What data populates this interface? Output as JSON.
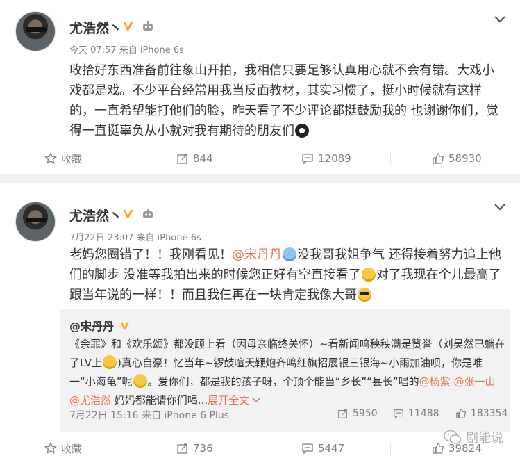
{
  "posts": [
    {
      "username": "尤浩然丶",
      "meta": "今天 07:57 来自 iPhone 6s",
      "text": "收拾好东西准备前往象山开拍，我相信只要足够认真用心就不会有错。大戏小戏都是戏。不少平台经常用我当反面教材，其实习惯了，挺小时候就有这样的，一直希望能打他们的脸，昨天看了不少评论都挺鼓励我的 也谢谢你们，觉得一直挺辜负从小就对我有期待的朋友们",
      "actions": {
        "favorite": "收藏",
        "repost": "844",
        "comment": "12089",
        "like": "58930"
      }
    },
    {
      "username": "尤浩然丶",
      "meta": "7月22日 23:07 来自 iPhone 6s",
      "text_parts": [
        "老妈您圈错了！！我刚看见！",
        "@宋丹丹",
        "没我哥我姐争气 还得接着努力追上他们的脚步 没准等我拍出来的时候您正好有空直接看了",
        "对了我现在个儿最高了跟当年说的一样！！而且我仨再在一块肯定我像大哥"
      ],
      "repost": {
        "username": "@宋丹丹",
        "text_parts": [
          "《余罪》和《欢乐颂》都没顾上看（因母亲临终关怀）~看新闻呜秧秧满是赞誉（刘昊然已躺在了LV上",
          ")真心自豪！忆当年~锣鼓喧天鞭炮齐鸣红旗招展银三银海~小雨加油呗，你是唯一“小海龟”呢",
          "。爱你们，都是我的孩子呀，个顶个能当“乡长”“县长”唱的",
          "@杨紫",
          "@张一山",
          "@尤浩然",
          "妈妈都能请你们喝...",
          "展开全文"
        ],
        "meta": "7月22日 15:16 来自 iPhone 6 Plus",
        "actions": {
          "repost": "5950",
          "comment": "11488",
          "like": "183354"
        }
      },
      "actions": {
        "favorite": "收藏",
        "repost": "736",
        "comment": "5447",
        "like": "39824"
      }
    }
  ],
  "watermark": "剧能说",
  "icons": [
    "verified-v-icon",
    "robot-badge-icon",
    "chevron-down-icon",
    "star-icon",
    "repost-icon",
    "comment-icon",
    "like-icon",
    "wechat-icon"
  ],
  "colors": {
    "accent": "#eb7350",
    "verified": "#f5a623",
    "text_muted": "#808080"
  }
}
